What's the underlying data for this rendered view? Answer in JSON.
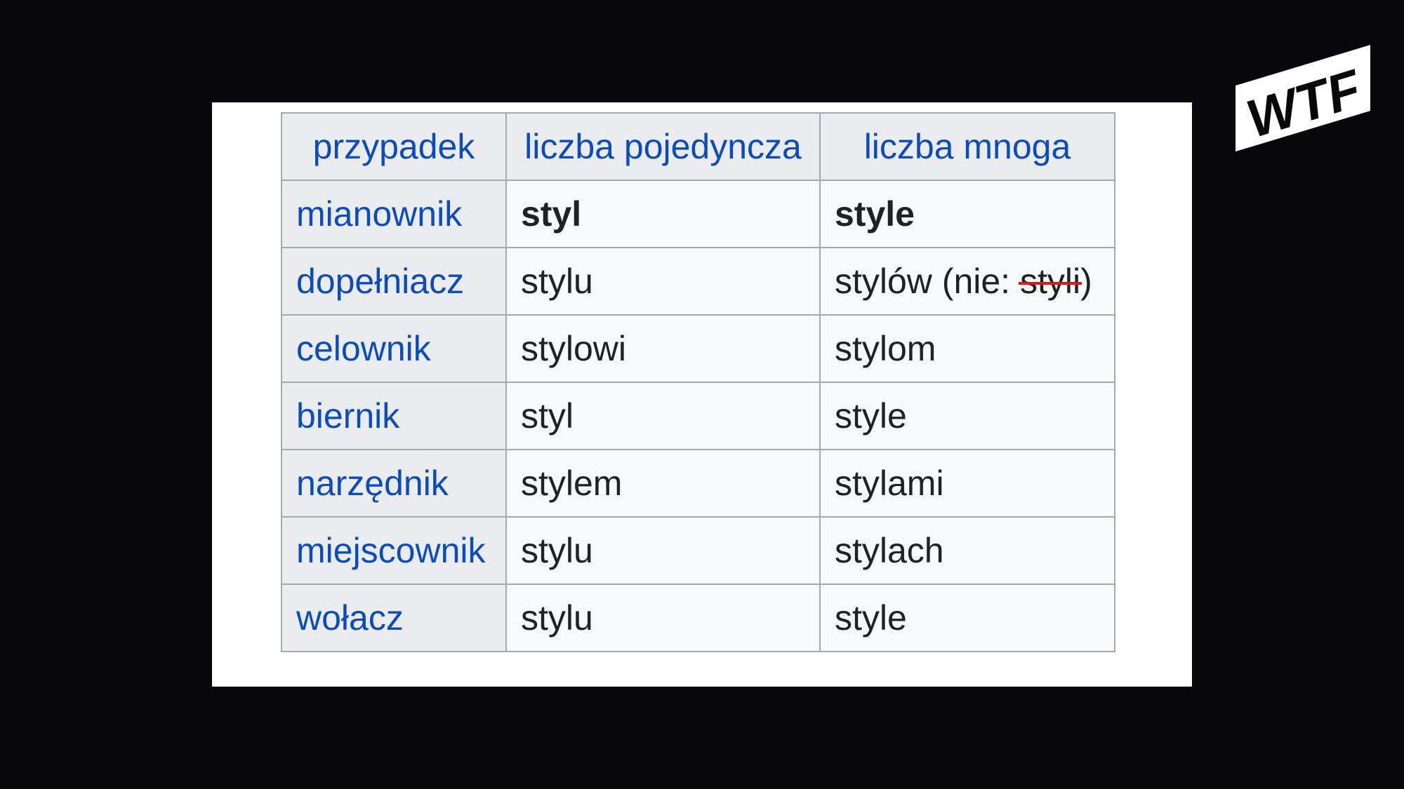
{
  "table": {
    "headers": [
      "przypadek",
      "liczba pojedyncza",
      "liczba mnoga"
    ],
    "rows": [
      {
        "case": "mianownik",
        "singular": "styl",
        "plural": "style"
      },
      {
        "case": "dopełniacz",
        "singular": "stylu",
        "plural_prefix": "stylów (nie: ",
        "plural_struck": "styli",
        "plural_suffix": ")"
      },
      {
        "case": "celownik",
        "singular": "stylowi",
        "plural": "stylom"
      },
      {
        "case": "biernik",
        "singular": "styl",
        "plural": "style"
      },
      {
        "case": "narzędnik",
        "singular": "stylem",
        "plural": "stylami"
      },
      {
        "case": "miejscownik",
        "singular": "stylu",
        "plural": "stylach"
      },
      {
        "case": "wołacz",
        "singular": "stylu",
        "plural": "style"
      }
    ]
  },
  "logo": {
    "text": "WTF"
  },
  "colors": {
    "background": "#08070c",
    "link": "#0b4bbd",
    "header_bg": "#eaecf0",
    "cell_bg": "#f8f9fa",
    "border": "#a2a9b1",
    "strike": "#d11c1c"
  }
}
